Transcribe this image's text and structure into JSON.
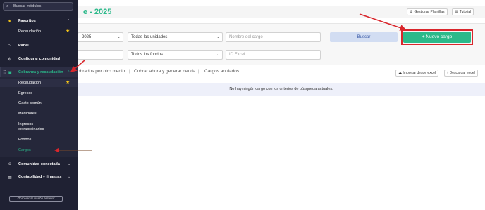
{
  "colors": {
    "accent": "#2bb98a",
    "sidebar_bg": "#1f2133",
    "annotation_red": "#d9262c",
    "star": "#f5c518"
  },
  "header": {
    "title_fragment": "e - 2025",
    "plantillas_label": "Gestionar Plantillas",
    "tutorial_label": "Tutorial",
    "plantillas_icon": "gear-icon",
    "tutorial_icon": "book-icon"
  },
  "filters": {
    "year_value": "2025",
    "units_value": "Todas las unidades",
    "cargo_name_placeholder": "Nombre del cargo",
    "funds_value": "Todos los fondos",
    "id_excel_placeholder": "ID Excel",
    "buscar_label": "Buscar",
    "nuevo_cargo_label": "+ Nuevo cargo"
  },
  "tabs": {
    "tab1": "obrados por otro medio",
    "sep": "|",
    "tab2": "Cobrar ahora y generar deuda",
    "tab3": "Cargos anulados",
    "import_label": "Importar desde excel",
    "export_label": "Descargar excel"
  },
  "table": {
    "empty_message": "No hay ningún cargo con los criterios de búsqueda actuales."
  },
  "sidebar": {
    "search_placeholder": "Buscar módulos",
    "favoritos": "Favoritos",
    "fav_recaudacion": "Recaudación",
    "panel": "Panel",
    "configurar": "Configurar comunidad",
    "cobranza": "Cobranza y recaudación",
    "sub_items": [
      "Recaudación",
      "Egresos",
      "Gasto común",
      "Medidores",
      "Ingresos",
      "extraordinarios",
      "Fondos",
      "Cargos"
    ],
    "comunidad_conectada": "Comunidad conectada",
    "contabilidad": "Contabilidad y finanzas",
    "volver": "Volver al diseño anterior"
  }
}
